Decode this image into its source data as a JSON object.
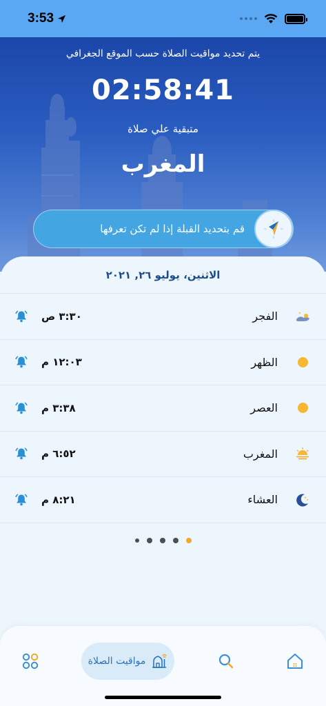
{
  "status_bar": {
    "time": "3:53"
  },
  "hero": {
    "note": "يتم تحديد مواقيت الصلاة حسب الموقع الجغرافي",
    "countdown": "02:58:41",
    "remaining_label": "متبقية علي صلاة",
    "next_prayer": "المغرب",
    "qibla_button": "قم بتحديد القبلة إذا لم تكن تعرفها"
  },
  "date": "الاثنين، يوليو ٢٦, ٢٠٢١",
  "prayers": [
    {
      "name": "الفجر",
      "time": "٣:٣٠ ص",
      "icon": "moon-stars-icon"
    },
    {
      "name": "الظهر",
      "time": "١٢:٠٣ م",
      "icon": "sun-icon"
    },
    {
      "name": "العصر",
      "time": "٣:٣٨ م",
      "icon": "sun-icon"
    },
    {
      "name": "المغرب",
      "time": "٦:٥٢ م",
      "icon": "sunset-icon"
    },
    {
      "name": "العشاء",
      "time": "٨:٢١ م",
      "icon": "crescent-moon-icon"
    }
  ],
  "pager": {
    "count": 5,
    "active_index": 4
  },
  "nav": {
    "prayer_times_label": "مواقيت الصلاة"
  },
  "colors": {
    "accent": "#2b73b8",
    "sun": "#f7b731",
    "active_dot": "#f0a92b",
    "hero_top": "#1b46a9"
  }
}
